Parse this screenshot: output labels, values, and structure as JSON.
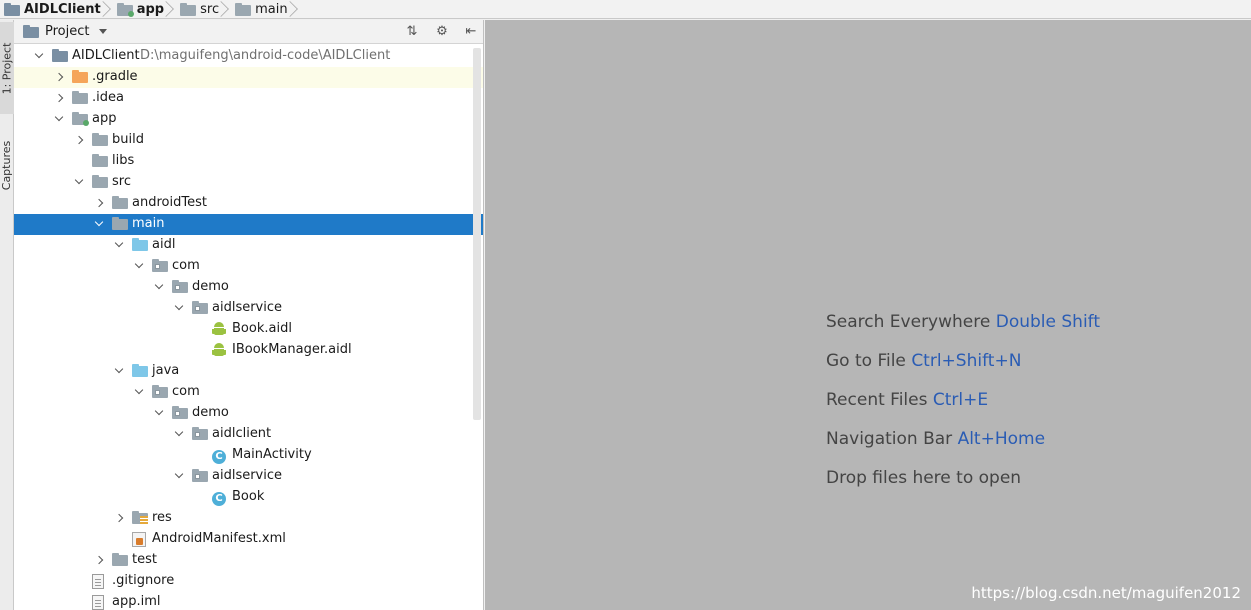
{
  "breadcrumb": [
    {
      "label": "AIDLClient",
      "bold": true,
      "icon": "project-icon"
    },
    {
      "label": "app",
      "bold": true,
      "icon": "module-folder-icon"
    },
    {
      "label": "src",
      "bold": false,
      "icon": "folder-icon"
    },
    {
      "label": "main",
      "bold": false,
      "icon": "folder-icon"
    }
  ],
  "tool_strip": {
    "project_tab": "1: Project",
    "captures_tab": "Captures"
  },
  "panel": {
    "title": "Project",
    "collapse_icon": "collapse-all-icon",
    "settings_icon": "gear-icon",
    "hide_icon": "hide-panel-icon"
  },
  "tree": [
    {
      "label": "AIDLClient",
      "path": "D:\\maguifeng\\android-code\\AIDLClient",
      "depth": 0,
      "expand": "down",
      "icon": "project"
    },
    {
      "label": ".gradle",
      "depth": 1,
      "expand": "right",
      "icon": "folder-orange",
      "highlight": true
    },
    {
      "label": ".idea",
      "depth": 1,
      "expand": "right",
      "icon": "folder-gray"
    },
    {
      "label": "app",
      "depth": 1,
      "expand": "down",
      "icon": "folder-module"
    },
    {
      "label": "build",
      "depth": 2,
      "expand": "right",
      "icon": "folder-gray"
    },
    {
      "label": "libs",
      "depth": 2,
      "expand": "none",
      "icon": "folder-gray"
    },
    {
      "label": "src",
      "depth": 2,
      "expand": "down",
      "icon": "folder-gray"
    },
    {
      "label": "androidTest",
      "depth": 3,
      "expand": "right",
      "icon": "folder-gray"
    },
    {
      "label": "main",
      "depth": 3,
      "expand": "down",
      "icon": "folder-gray",
      "selected": true
    },
    {
      "label": "aidl",
      "depth": 4,
      "expand": "down",
      "icon": "folder-blue"
    },
    {
      "label": "com",
      "depth": 5,
      "expand": "down",
      "icon": "package"
    },
    {
      "label": "demo",
      "depth": 6,
      "expand": "down",
      "icon": "package"
    },
    {
      "label": "aidlservice",
      "depth": 7,
      "expand": "down",
      "icon": "package"
    },
    {
      "label": "Book.aidl",
      "depth": 8,
      "expand": "none",
      "icon": "android"
    },
    {
      "label": "IBookManager.aidl",
      "depth": 8,
      "expand": "none",
      "icon": "android"
    },
    {
      "label": "java",
      "depth": 4,
      "expand": "down",
      "icon": "folder-blue"
    },
    {
      "label": "com",
      "depth": 5,
      "expand": "down",
      "icon": "package"
    },
    {
      "label": "demo",
      "depth": 6,
      "expand": "down",
      "icon": "package"
    },
    {
      "label": "aidlclient",
      "depth": 7,
      "expand": "down",
      "icon": "package"
    },
    {
      "label": "MainActivity",
      "depth": 8,
      "expand": "none",
      "icon": "class"
    },
    {
      "label": "aidlservice",
      "depth": 7,
      "expand": "down",
      "icon": "package"
    },
    {
      "label": "Book",
      "depth": 8,
      "expand": "none",
      "icon": "class"
    },
    {
      "label": "res",
      "depth": 4,
      "expand": "right",
      "icon": "res"
    },
    {
      "label": "AndroidManifest.xml",
      "depth": 4,
      "expand": "none",
      "icon": "xml"
    },
    {
      "label": "test",
      "depth": 3,
      "expand": "right",
      "icon": "folder-gray"
    },
    {
      "label": ".gitignore",
      "depth": 2,
      "expand": "none",
      "icon": "file"
    },
    {
      "label": "app.iml",
      "depth": 2,
      "expand": "none",
      "icon": "file"
    }
  ],
  "editor": {
    "hints": [
      {
        "text": "Search Everywhere",
        "shortcut": "Double Shift"
      },
      {
        "text": "Go to File",
        "shortcut": "Ctrl+Shift+N"
      },
      {
        "text": "Recent Files",
        "shortcut": "Ctrl+E"
      },
      {
        "text": "Navigation Bar",
        "shortcut": "Alt+Home"
      },
      {
        "text": "Drop files here to open",
        "shortcut": ""
      }
    ],
    "watermark": "https://blog.csdn.net/maguifen2012"
  },
  "colors": {
    "selection": "#1f7ac8",
    "shortcut": "#2a5cb4",
    "editor_bg": "#b6b6b6",
    "highlight_row": "#fcfce8"
  }
}
